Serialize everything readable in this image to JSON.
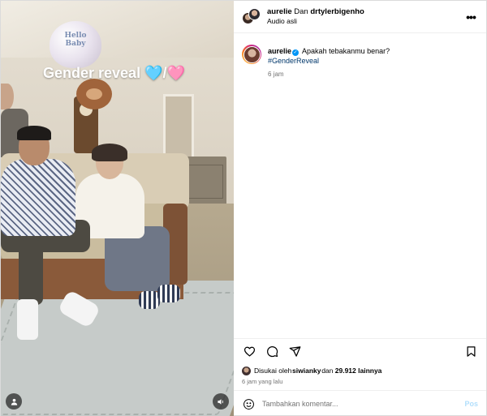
{
  "media": {
    "overlay_title": "Gender reveal",
    "overlay_emoji_blue": "🩵",
    "overlay_separator": "/",
    "overlay_emoji_pink": "🩷",
    "balloon_text": "Hello Baby",
    "tags_icon": "person-tag-icon",
    "mute_icon": "speaker-icon"
  },
  "header": {
    "username": "aurelie",
    "connector": "Dan",
    "collaborator": "drtylerbigenho",
    "audio": "Audio asli",
    "more_icon": "•••"
  },
  "caption": {
    "username": "aurelie",
    "verified_mark": "✓",
    "text": "Apakah tebakanmu benar?",
    "hashtag": "#GenderReveal",
    "time": "6 jam"
  },
  "actions": {
    "like_icon": "heart-icon",
    "comment_icon": "comment-icon",
    "share_icon": "share-icon",
    "save_icon": "bookmark-icon"
  },
  "likes": {
    "prefix": "Disukai oleh",
    "user": "siwianky",
    "middle": "dan",
    "count": "29.912",
    "suffix": "lainnya"
  },
  "post_time": "6 jam yang lalu",
  "comment_box": {
    "placeholder": "Tambahkan komentar...",
    "post_label": "Pos"
  },
  "colors": {
    "link": "#00376b",
    "verified": "#0095f6",
    "post_button_disabled": "#b2dffc",
    "muted_text": "#737373"
  }
}
